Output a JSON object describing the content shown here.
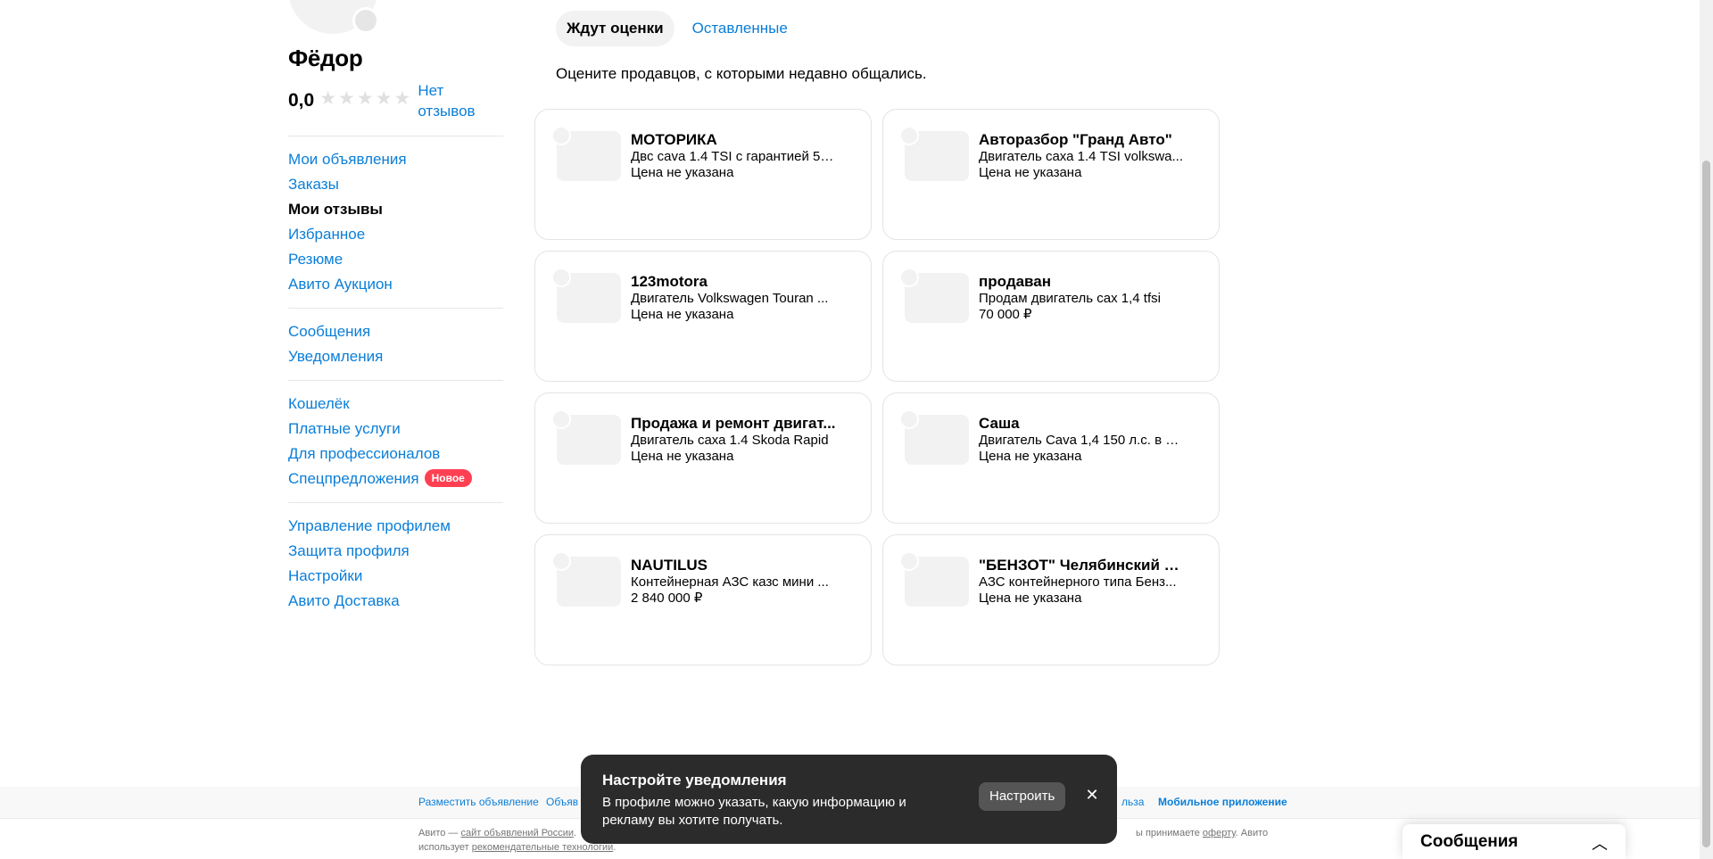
{
  "profile": {
    "name": "Фёдор",
    "rating": "0,0",
    "reviews_link": "Нет отзывов"
  },
  "menu": {
    "group1": [
      {
        "label": "Мои объявления",
        "active": false
      },
      {
        "label": "Заказы",
        "active": false
      },
      {
        "label": "Мои отзывы",
        "active": true
      },
      {
        "label": "Избранное",
        "active": false
      },
      {
        "label": "Резюме",
        "active": false
      },
      {
        "label": "Авито Аукцион",
        "active": false
      }
    ],
    "group2": [
      {
        "label": "Сообщения"
      },
      {
        "label": "Уведомления"
      }
    ],
    "group3": [
      {
        "label": "Кошелёк"
      },
      {
        "label": "Платные услуги"
      },
      {
        "label": "Для профессионалов"
      },
      {
        "label": "Спецпредложения",
        "badge": "Новое"
      }
    ],
    "group4": [
      {
        "label": "Управление профилем"
      },
      {
        "label": "Защита профиля"
      },
      {
        "label": "Настройки"
      },
      {
        "label": "Авито Доставка"
      }
    ]
  },
  "tabs": [
    {
      "label": "Ждут оценки",
      "active": true
    },
    {
      "label": "Оставленные",
      "active": false
    }
  ],
  "subtitle": "Оцените продавцов, с которыми недавно общались.",
  "cards": [
    {
      "seller": "МОТОРИКА",
      "title": "Двс cava 1.4 TSI с гарантией 50...",
      "price": "Цена не указана"
    },
    {
      "seller": "Авторазбор \"Гранд Авто\"",
      "title": "Двигатель саха 1.4 TSI volkswa...",
      "price": "Цена не указана"
    },
    {
      "seller": "123motora",
      "title": "Двигатель Volkswagen Touran ...",
      "price": "Цена не указана"
    },
    {
      "seller": "продаван",
      "title": "Продам двигатель сах 1,4 tfsi",
      "price": "70 000 ₽"
    },
    {
      "seller": "Продажа и ремонт двигат...",
      "title": "Двигатель саха 1.4 Skoda Rapid",
      "price": "Цена не указана"
    },
    {
      "seller": "Саша",
      "title": "Двигатель Cava 1,4 150 л.с. в ра...",
      "price": "Цена не указана"
    },
    {
      "seller": "NAUTILUS",
      "title": "Контейнерная АЗС казс мини ...",
      "price": "2 840 000 ₽"
    },
    {
      "seller": "\"БЕНЗОТ\" Челябинский з...",
      "title": "АЗС контейнерного типа Бенз...",
      "price": "Цена не указана"
    }
  ],
  "footer": {
    "link_post": "Разместить объявление",
    "link_ads": "Объяв",
    "link_rules": "льза",
    "link_mobile": "Мобильное приложение",
    "text_prefix": "Авито — ",
    "text_site_link": "сайт объявлений России",
    "text_middle": ". ",
    "text_accept": "ы принимаете ",
    "text_offer": "оферту",
    "text_after_offer": ". Авито",
    "text_line2_prefix": "использует ",
    "text_tech": "рекомендательные технологии",
    "text_line2_suffix": "."
  },
  "toast": {
    "title": "Настройте уведомления",
    "text": "В профиле можно указать, какую информацию и рекламу вы хотите получать.",
    "button": "Настроить",
    "close": "✕"
  },
  "messenger": {
    "label": "Сообщения",
    "chevron": "︿"
  },
  "colors": {
    "link": "#0a7ed8",
    "badge": "#ff4053",
    "toast_bg": "#2b2b2b"
  }
}
